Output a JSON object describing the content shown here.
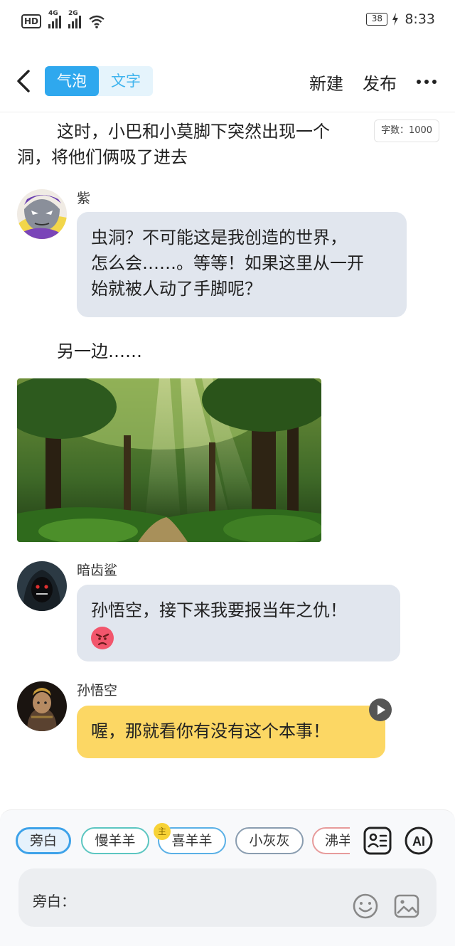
{
  "status": {
    "hd": "HD",
    "net1": "4G",
    "net2": "2G",
    "battery": "38",
    "time": "8:33"
  },
  "header": {
    "tabs": [
      {
        "label": "气泡",
        "active": true
      },
      {
        "label": "文字",
        "active": false
      }
    ],
    "new_label": "新建",
    "publish_label": "发布"
  },
  "word_count": "字数：1000",
  "story": {
    "narration1_line1": "这时，小巴和小莫脚下突然出现一个",
    "narration1_line2": "洞，将他们俩吸了进去",
    "msg1": {
      "name": "紫",
      "lines": [
        "虫洞？不可能这是我创造的世界，",
        "怎么会……。等等！如果这里从一开",
        "始就被人动了手脚呢？"
      ]
    },
    "narration2": "另一边……",
    "msg2": {
      "name": "暗齿鲨",
      "text": "孙悟空，接下来我要报当年之仇！"
    },
    "msg3": {
      "name": "孙悟空",
      "text": "喔，那就看你有没有这个本事！"
    }
  },
  "roles": [
    {
      "label": "旁白",
      "selected": true,
      "color": "#3da2e9"
    },
    {
      "label": "慢羊羊",
      "selected": false,
      "color": "#5cc6c1"
    },
    {
      "label": "喜羊羊",
      "selected": false,
      "color": "#5ab0e6",
      "badge": "主"
    },
    {
      "label": "小灰灰",
      "selected": false,
      "color": "#8a9db0"
    },
    {
      "label": "沸羊",
      "selected": false,
      "color": "#e79b9b"
    }
  ],
  "input": {
    "placeholder": "旁白："
  },
  "colors": {
    "accent": "#2fa8ee",
    "bubble_gray": "#e1e6ee",
    "bubble_yellow": "#fcd764"
  }
}
